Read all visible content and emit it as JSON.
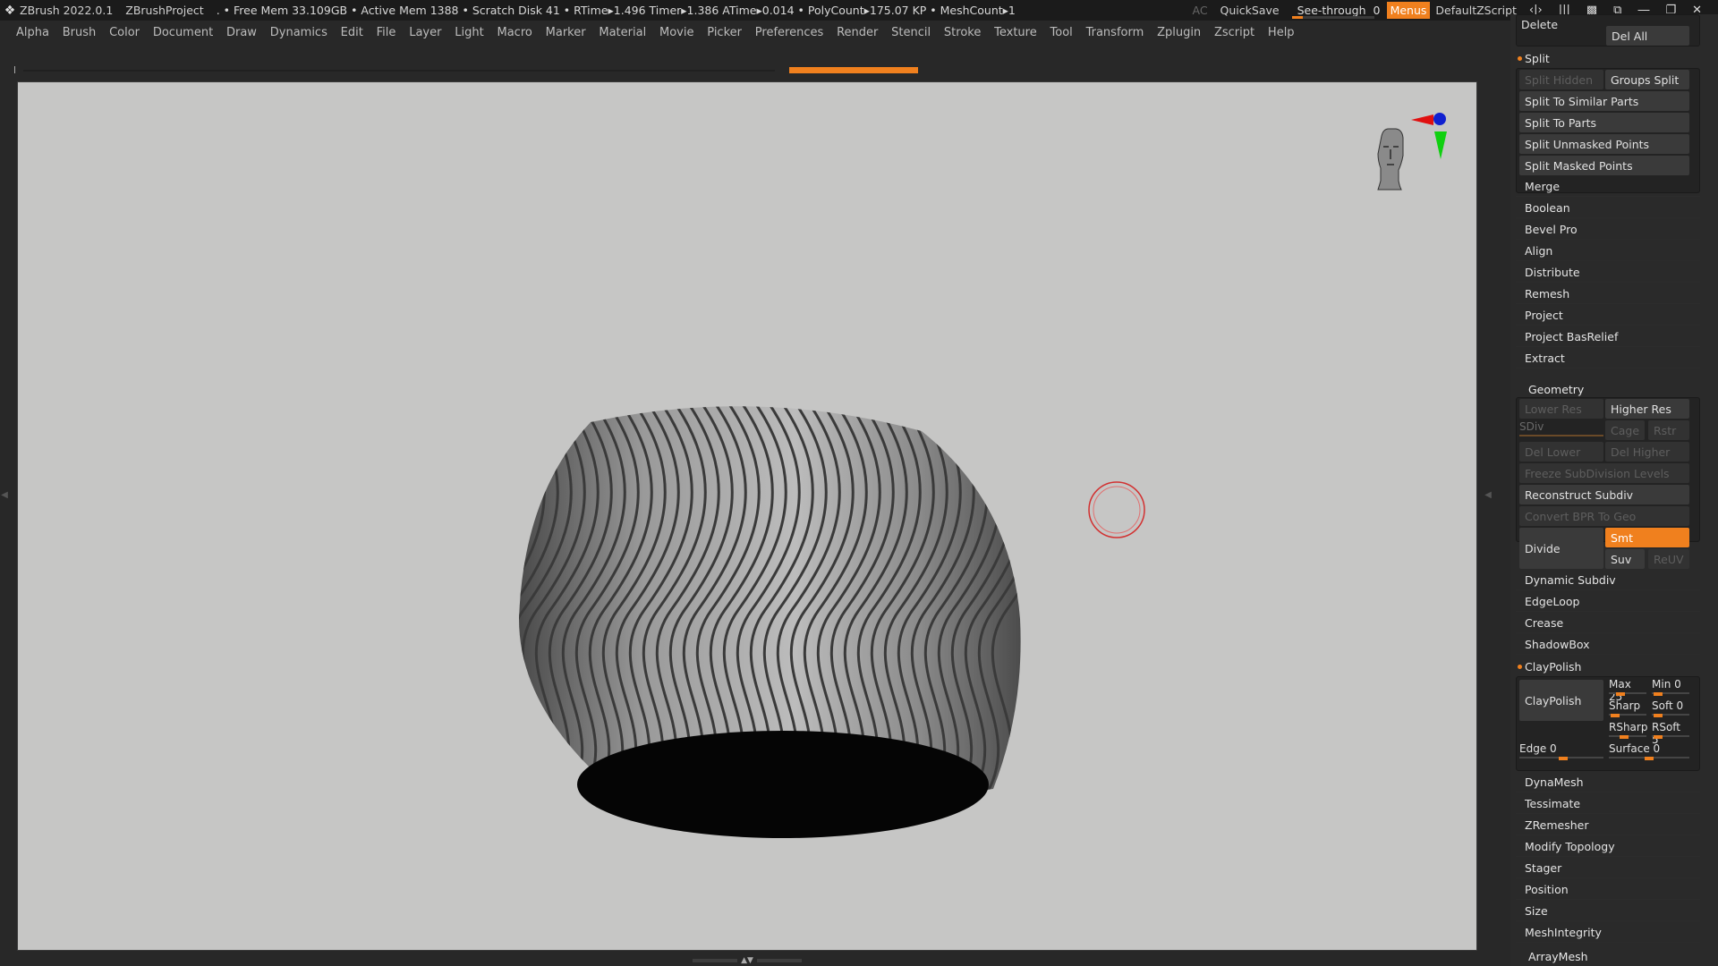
{
  "titlebar": {
    "app": "ZBrush 2022.0.1",
    "project": "ZBrushProject",
    "status": ". • Free Mem 33.109GB • Active Mem 1388 • Scratch Disk 41 •  RTime▸1.496 Timer▸1.386 ATime▸0.014 • PolyCount▸175.07 KP  • MeshCount▸1",
    "ac": "AC",
    "quicksave": "QuickSave",
    "see_through_label": "See-through",
    "see_through_value": "0",
    "see_through_fill": 0.0,
    "menus": "Menus",
    "script": "DefaultZScript"
  },
  "menubar": [
    "Alpha",
    "Brush",
    "Color",
    "Document",
    "Draw",
    "Dynamics",
    "Edit",
    "File",
    "Layer",
    "Light",
    "Macro",
    "Marker",
    "Material",
    "Movie",
    "Picker",
    "Preferences",
    "Render",
    "Stencil",
    "Stroke",
    "Texture",
    "Tool",
    "Transform",
    "Zplugin",
    "Zscript",
    "Help"
  ],
  "panel": {
    "delete": "Delete",
    "del_all": "Del All",
    "split_header": "Split",
    "split_hidden": "Split Hidden",
    "groups_split": "Groups Split",
    "split_similar": "Split To Similar Parts",
    "split_parts": "Split To Parts",
    "split_unmasked": "Split Unmasked Points",
    "split_masked": "Split Masked Points",
    "subtool_items": [
      "Merge",
      "Boolean",
      "Bevel Pro",
      "Align",
      "Distribute",
      "Remesh",
      "Project",
      "Project BasRelief",
      "Extract"
    ],
    "geometry_header": "Geometry",
    "lower_res": "Lower Res",
    "higher_res": "Higher Res",
    "sdiv": "SDiv",
    "cage": "Cage",
    "rstr": "Rstr",
    "del_lower": "Del Lower",
    "del_higher": "Del Higher",
    "freeze": "Freeze SubDivision Levels",
    "reconstruct": "Reconstruct Subdiv",
    "convert_bpr": "Convert BPR To Geo",
    "divide": "Divide",
    "smt": "Smt",
    "suv": "Suv",
    "reuv": "ReUV",
    "dynamic_subdiv": "Dynamic Subdiv",
    "edgeloop": "EdgeLoop",
    "crease": "Crease",
    "shadowbox": "ShadowBox",
    "claypolish_header": "ClayPolish",
    "claypolish_btn": "ClayPolish",
    "max": "Max 25",
    "min": "Min 0",
    "sharp": "Sharp",
    "soft": "Soft 0",
    "rsharp": "RSharp",
    "rsoft": "RSoft 5",
    "edge": "Edge 0",
    "surface": "Surface 0",
    "geo_items": [
      "DynaMesh",
      "Tessimate",
      "ZRemesher",
      "Modify Topology",
      "Stager",
      "Position",
      "Size",
      "MeshIntegrity"
    ],
    "arraymesh": "ArrayMesh"
  }
}
